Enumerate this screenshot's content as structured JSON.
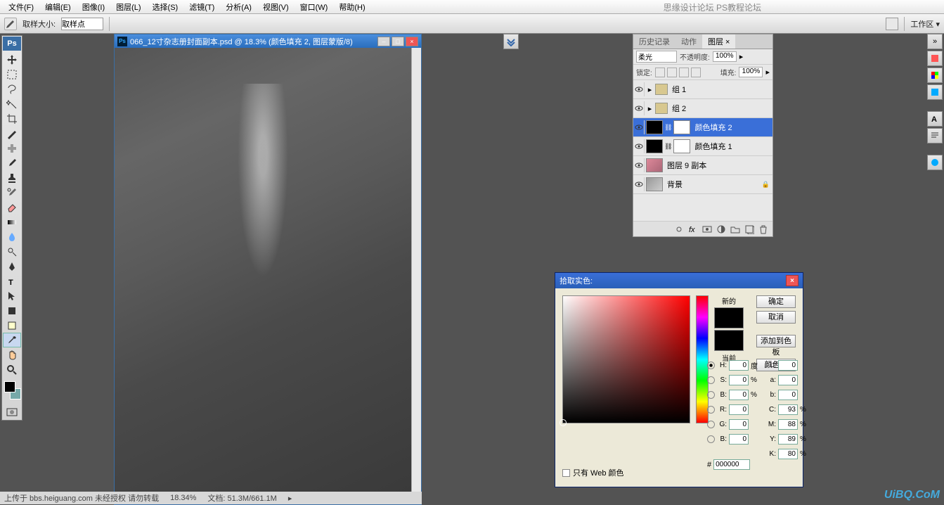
{
  "menu": {
    "file": "文件(F)",
    "edit": "编辑(E)",
    "image": "图像(I)",
    "layer": "图层(L)",
    "select": "选择(S)",
    "filter": "滤镜(T)",
    "analysis": "分析(A)",
    "view": "视图(V)",
    "window": "窗口(W)",
    "help": "帮助(H)"
  },
  "opt": {
    "sampleSize": "取样大小:",
    "samplePoint": "取样点",
    "workspaceLbl": "工作区 ▾"
  },
  "docTitle": "066_12寸杂志册封面副本.psd @ 18.3% (颜色填充 2, 图层蒙版/8)",
  "panel": {
    "tabs": {
      "history": "历史记录",
      "actions": "动作",
      "layers": "图层 ×"
    },
    "blendMode": "柔光",
    "opacityLbl": "不透明度:",
    "opacityVal": "100%",
    "lockLbl": "锁定:",
    "fillLbl": "填充:",
    "fillVal": "100%"
  },
  "layers": [
    {
      "name": "组 1",
      "type": "group",
      "vis": true
    },
    {
      "name": "组 2",
      "type": "group",
      "vis": true
    },
    {
      "name": "颜色填充 2",
      "type": "fill",
      "sel": true,
      "vis": true
    },
    {
      "name": "颜色填充 1",
      "type": "fill",
      "vis": true
    },
    {
      "name": "图层 9 副本",
      "type": "img",
      "vis": true
    },
    {
      "name": "背景",
      "type": "bg",
      "vis": true,
      "locked": true
    }
  ],
  "picker": {
    "title": "拾取实色:",
    "ok": "确定",
    "cancel": "取消",
    "addSwatch": "添加到色板",
    "colorLib": "颜色库",
    "newLbl": "新的",
    "curLbl": "当前",
    "webOnly": "只有 Web 颜色",
    "H": "0",
    "S": "0",
    "B": "0",
    "R": "0",
    "G": "0",
    "Bv": "0",
    "L": "0",
    "a": "0",
    "b": "0",
    "C": "93",
    "M": "88",
    "Y": "89",
    "K": "80",
    "hex": "000000",
    "degUnit": "度",
    "pctUnit": "%"
  },
  "status": {
    "upload": "上传于 bbs.heiguang.com  未经授权  请勿转载",
    "zoom": "18.34%",
    "docInfo": "文档: 51.3M/661.1M"
  },
  "watermark": {
    "tr": "思缘设计论坛  PS教程论坛",
    "br": "UiBQ.CoM"
  }
}
